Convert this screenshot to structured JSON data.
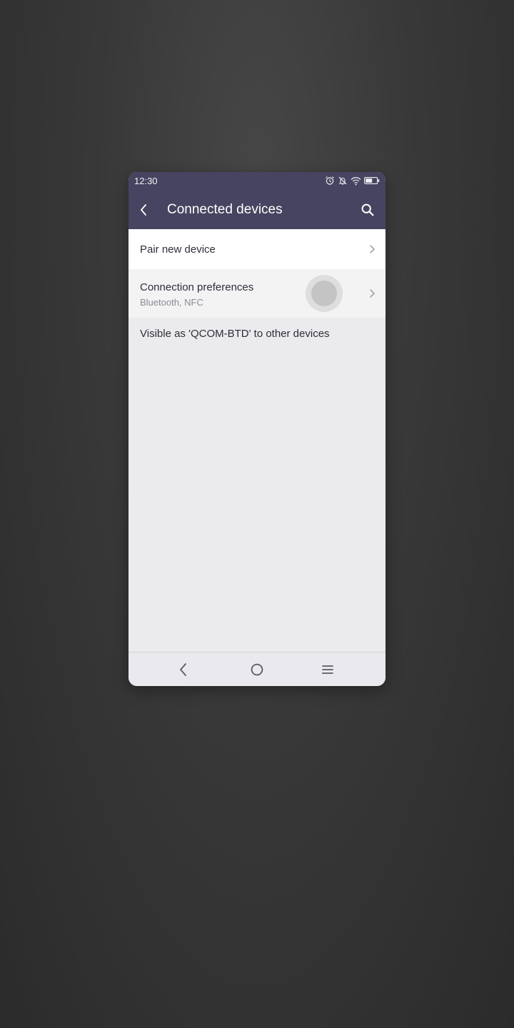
{
  "status_bar": {
    "time": "12:30",
    "icons": [
      "alarm-icon",
      "notifications-off-icon",
      "wifi-icon",
      "battery-icon"
    ]
  },
  "toolbar": {
    "title": "Connected devices",
    "back_icon": "back-arrow-icon",
    "search_icon": "search-icon"
  },
  "settings": {
    "items": [
      {
        "title": "Pair new device",
        "subtitle": ""
      },
      {
        "title": "Connection preferences",
        "subtitle": "Bluetooth, NFC"
      }
    ],
    "visible_as": "Visible as 'QCOM-BTD' to other devices"
  },
  "nav_bar": {
    "buttons": [
      "nav-back-icon",
      "nav-home-icon",
      "nav-menu-icon"
    ]
  },
  "colors": {
    "header_bg": "#464460",
    "content_bg": "#ebebed",
    "row_bg": "#ffffff",
    "text_primary": "#2e2e3a",
    "text_secondary": "#8a8a94"
  }
}
